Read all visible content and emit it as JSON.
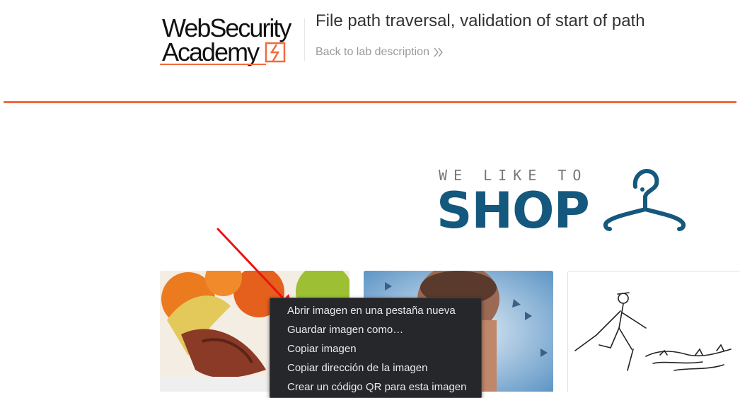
{
  "header": {
    "logo_line1": "WebSecurity",
    "logo_line2": "Academy",
    "lab_title": "File path traversal, validation of start of path",
    "back_link": "Back to lab description",
    "accent_color": "#f26a3d"
  },
  "shop_logo": {
    "tagline": "WE LIKE TO",
    "word": "SHOP",
    "brand_color": "#15587d"
  },
  "context_menu": {
    "items": [
      "Abrir imagen en una pestaña nueva",
      "Guardar imagen como…",
      "Copiar imagen",
      "Copiar dirección de la imagen",
      "Crear un código QR para esta imagen"
    ]
  }
}
